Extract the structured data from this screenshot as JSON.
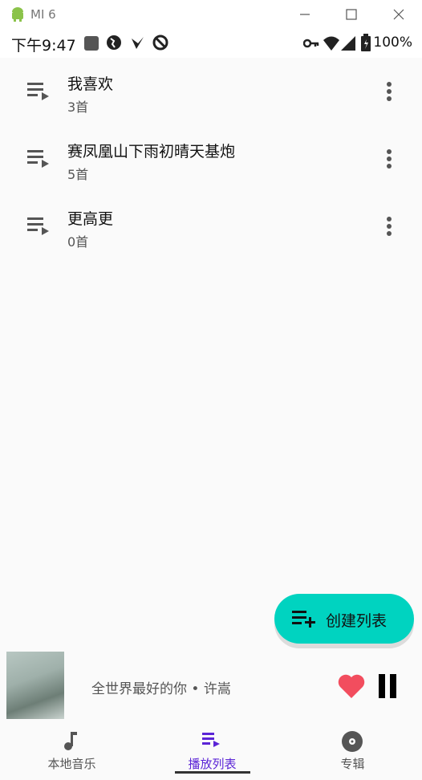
{
  "window": {
    "title": "MI 6",
    "icons": [
      "android-icon",
      "minimize-icon",
      "maximize-icon",
      "close-icon"
    ]
  },
  "status_bar": {
    "time": "下午9:47",
    "battery": "100%",
    "icons": [
      "stop-icon",
      "globe-icon",
      "check-icon",
      "block-icon",
      "key-icon",
      "wifi-icon",
      "signal-icon",
      "battery-icon"
    ]
  },
  "playlists": [
    {
      "title": "我喜欢",
      "count": "3首"
    },
    {
      "title": "赛凤凰山下雨初晴天基炮",
      "count": "5首"
    },
    {
      "title": "更高更",
      "count": "0首"
    }
  ],
  "fab": {
    "label": "创建列表",
    "icon": "playlist-add-icon",
    "color": "#00d3c0"
  },
  "now_playing": {
    "text": "全世界最好的你 • 许嵩",
    "icons": [
      "heart-icon",
      "pause-icon"
    ],
    "heart_color": "#f24d5e"
  },
  "bottom_nav": [
    {
      "label": "本地音乐",
      "icon": "music-note-icon",
      "active": false
    },
    {
      "label": "播放列表",
      "icon": "playlist-play-icon",
      "active": true
    },
    {
      "label": "专辑",
      "icon": "album-icon",
      "active": false
    }
  ],
  "accent": "#5b24d6"
}
